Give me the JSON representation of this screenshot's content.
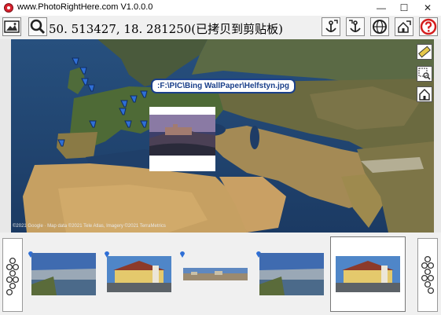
{
  "window": {
    "title": "www.PhotoRightHere.com V1.0.0.0",
    "minimize": "—",
    "maximize": "☐",
    "close": "✕"
  },
  "toolbar": {
    "coordinates": "50. 513427, 18. 281250(已拷贝到剪贴板)",
    "icons": [
      "image-icon",
      "search-icon",
      "anchor-in-icon",
      "anchor-out-icon",
      "globe-icon",
      "home-arrow-icon",
      "help-icon"
    ]
  },
  "map": {
    "tooltip": ":F:\\PIC\\Bing WallPaper\\Helfstyn.jpg",
    "credit": "©2021 Google · Map data ©2021 Tele Atlas, Imagery ©2021 TerraMetrics",
    "tools": [
      "ruler-icon",
      "zoom-select-icon",
      "home-icon"
    ]
  },
  "thumbnails": [
    "lake-photo",
    "castle-photo",
    "panorama-photo",
    "lake-photo-2",
    "castle-photo-2"
  ],
  "colors": {
    "tooltip_border": "#1a3f8a",
    "pin": "#2f6fd6",
    "help": "#d41d1d"
  }
}
